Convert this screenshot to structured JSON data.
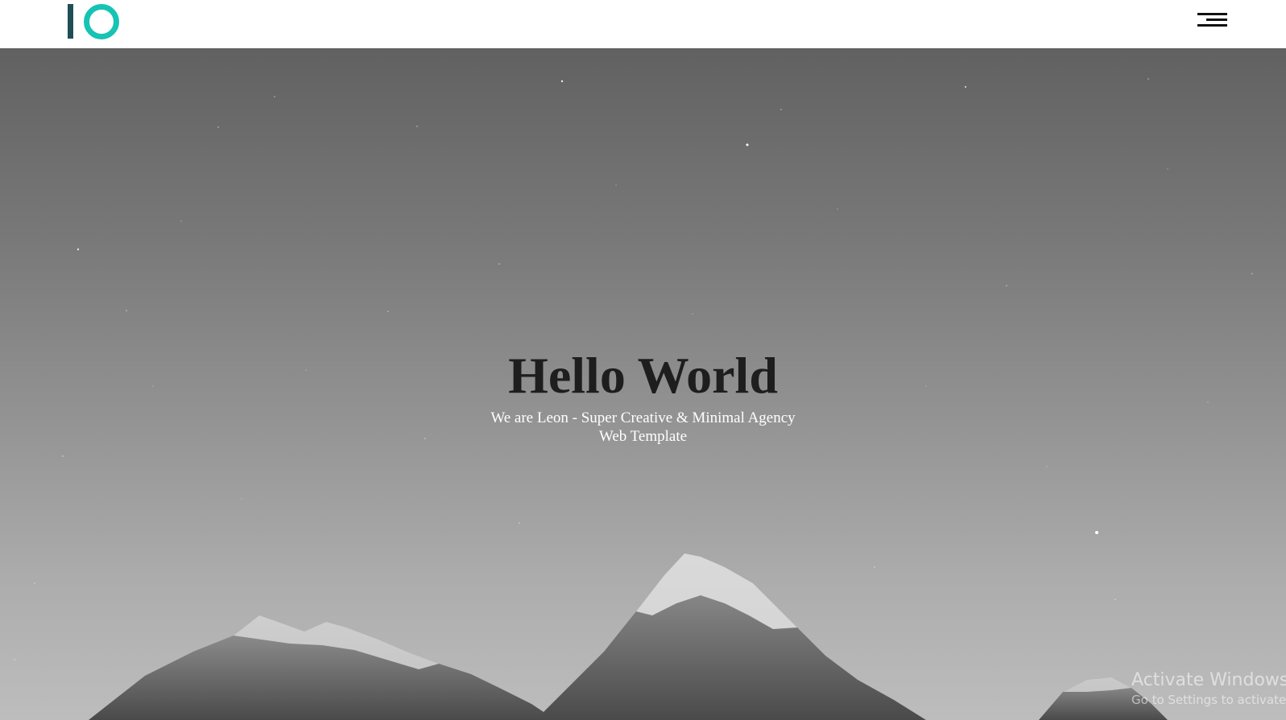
{
  "brand": {
    "logo_icon": "io-logo-icon",
    "logo_bar_color": "#1f4f55",
    "logo_ring_color": "#17c3b2"
  },
  "nav": {
    "menu_icon": "hamburger-menu-icon"
  },
  "hero": {
    "title": "Hello World",
    "subtitle": "We are Leon - Super Creative & Minimal Agency Web Template",
    "background_image": "mountain-peaks-night-sky-grayscale"
  },
  "os_watermark": {
    "line1": "Activate Windows",
    "line2": "Go to Settings to activate Windows."
  }
}
